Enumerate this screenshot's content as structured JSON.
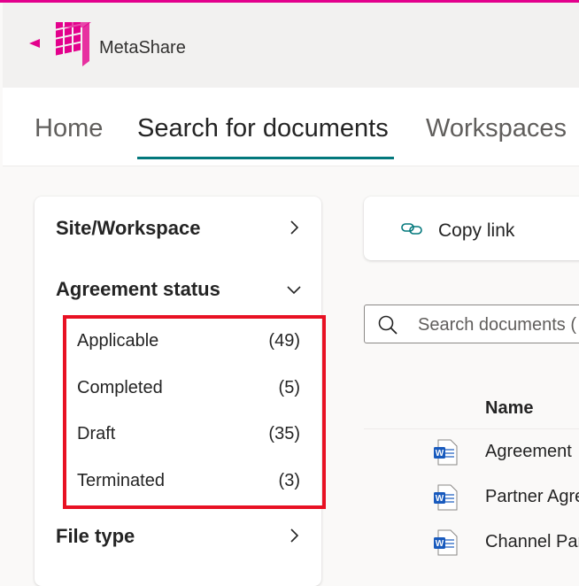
{
  "app": {
    "name": "MetaShare"
  },
  "nav": {
    "tabs": [
      {
        "label": "Home",
        "active": false
      },
      {
        "label": "Search for documents",
        "active": true
      },
      {
        "label": "Workspaces",
        "active": false
      }
    ]
  },
  "filters": {
    "site_workspace": {
      "title": "Site/Workspace",
      "expanded": false
    },
    "agreement_status": {
      "title": "Agreement status",
      "expanded": true,
      "items": [
        {
          "label": "Applicable",
          "count": "(49)"
        },
        {
          "label": "Completed",
          "count": "(5)"
        },
        {
          "label": "Draft",
          "count": "(35)"
        },
        {
          "label": "Terminated",
          "count": "(3)"
        }
      ]
    },
    "file_type": {
      "title": "File type",
      "expanded": false
    }
  },
  "toolbar": {
    "copy_link_label": "Copy link"
  },
  "search": {
    "placeholder": "Search documents ("
  },
  "documents": {
    "column_name": "Name",
    "rows": [
      {
        "name": "Agreement",
        "icon": "word-doc-icon"
      },
      {
        "name": "Partner Agre",
        "icon": "word-doc-icon"
      },
      {
        "name": "Channel Par",
        "icon": "word-doc-icon"
      }
    ]
  },
  "colors": {
    "accent_underline": "#03787c",
    "brand_pink": "#e3008c",
    "highlight_box": "#e81123",
    "word_blue": "#185abd"
  }
}
